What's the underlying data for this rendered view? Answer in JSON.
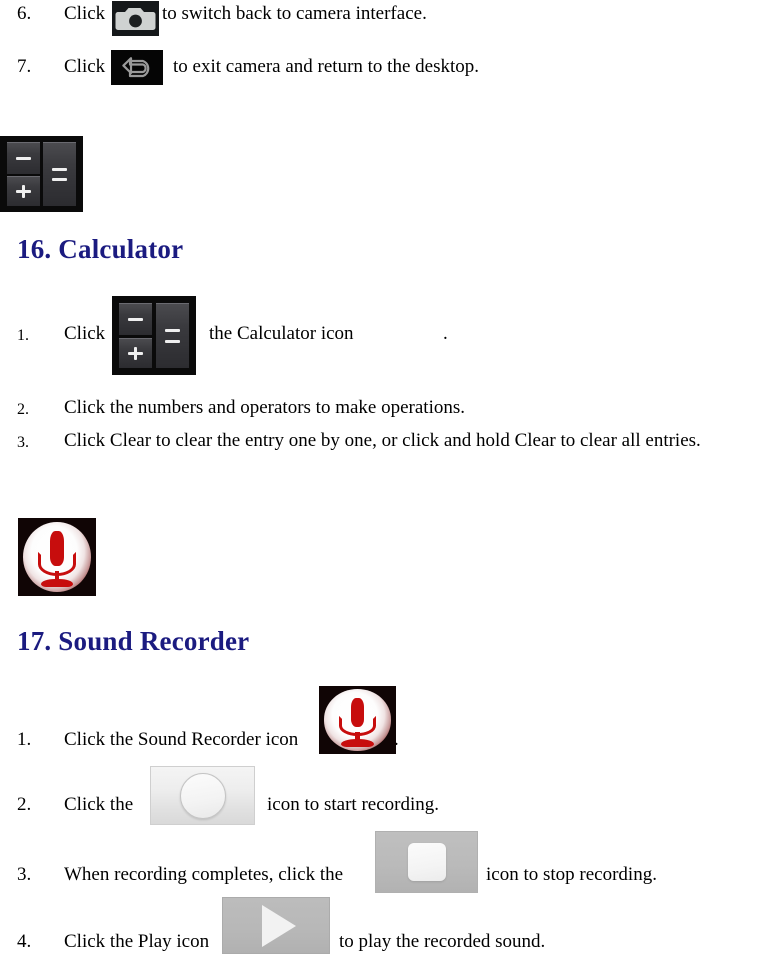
{
  "document": {
    "heading_color": "#1b1b80",
    "body_color": "#000000",
    "background": "#ffffff"
  },
  "camera_section": {
    "items": [
      {
        "number": "6.",
        "text_before": "Click",
        "icon": "camera-icon",
        "text_after": "to switch back to camera interface."
      },
      {
        "number": "7.",
        "text_before": "Click",
        "icon": "back-arrow-icon",
        "text_after": "to exit camera and return to the desktop."
      }
    ]
  },
  "calculator_section": {
    "icon": "calculator-icon",
    "heading": "16. Calculator",
    "items": [
      {
        "number": "1.",
        "text_before": "Click",
        "icon": "calculator-icon",
        "text_after": "the Calculator icon",
        "text_trailing": "."
      },
      {
        "number": "2.",
        "text": "Click the numbers and operators to make operations."
      },
      {
        "number": "3.",
        "text": "Click Clear to clear the entry one by one, or click and hold Clear to clear all entries."
      }
    ]
  },
  "sound_recorder_section": {
    "icon": "sound-recorder-icon",
    "heading": "17. Sound Recorder",
    "items": [
      {
        "number": "1.",
        "text": "Click the Sound Recorder icon",
        "icon": "sound-recorder-icon",
        "text_trailing": "."
      },
      {
        "number": "2.",
        "text_before": "Click the",
        "icon": "record-button-icon",
        "text_after": "icon to start recording."
      },
      {
        "number": "3.",
        "text_before": "When recording completes, click the",
        "icon": "stop-button-icon",
        "text_after": "icon to stop recording."
      },
      {
        "number": "4.",
        "text_before": "Click the Play icon",
        "icon": "play-button-icon",
        "text_after": "to play the recorded sound."
      }
    ]
  }
}
